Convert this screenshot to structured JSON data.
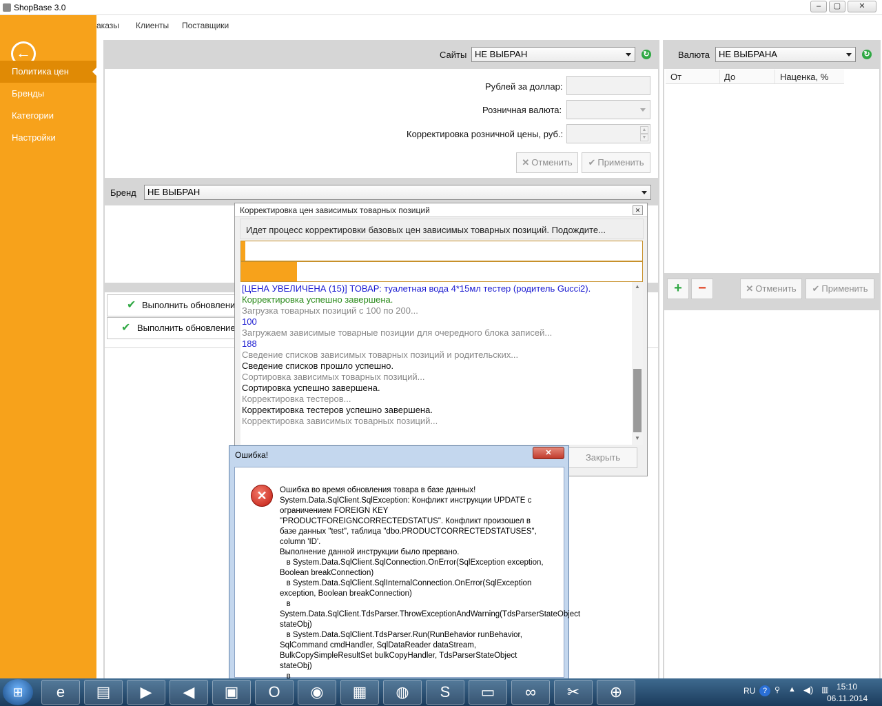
{
  "window": {
    "title": "ShopBase 3.0"
  },
  "top_tabs": [
    "аказы",
    "Клиенты",
    "Поставщики"
  ],
  "sidebar": {
    "items": [
      {
        "label": "Политика цен",
        "active": true
      },
      {
        "label": "Бренды"
      },
      {
        "label": "Категории"
      },
      {
        "label": "Настройки"
      }
    ]
  },
  "sites": {
    "label": "Сайты",
    "value": "НЕ ВЫБРАН"
  },
  "form": {
    "rub_per_dollar_label": "Рублей за доллар:",
    "retail_currency_label": "Розничная валюта:",
    "retail_correction_label": "Корректировка розничной цены, руб.:",
    "cancel_label": "Отменить",
    "apply_label": "Применить"
  },
  "brand": {
    "label": "Бренд",
    "value": "НЕ ВЫБРАН"
  },
  "actions": {
    "run_update_1": "Выполнить обновлени",
    "run_update_2": "Выполнить обновление"
  },
  "currency": {
    "label": "Валюта",
    "value": "НЕ ВЫБРАНА",
    "columns": [
      "От",
      "До",
      "Наценка, %"
    ],
    "cancel_label": "Отменить",
    "apply_label": "Применить",
    "add_icon": "plus-icon",
    "remove_icon": "minus-icon"
  },
  "dialog": {
    "title": "Корректировка цен зависимых товарных позиций",
    "message": "Идет процесс корректировки базовых цен зависимых товарных позиций. Подождите...",
    "progress1": 0.01,
    "progress2": 0.14,
    "log": [
      {
        "text": "[ЦЕНА УВЕЛИЧЕНА (15)] ТОВАР: туалетная вода 4*15мл тестер (родитель Gucci2).",
        "color": "#1a1ad0"
      },
      {
        "text": "Корректировка успешно завершена.",
        "color": "#2a8a1a"
      },
      {
        "text": "Загрузка товарных позиций с 100 по 200...",
        "color": "#888888"
      },
      {
        "text": "100",
        "color": "#1a1ad0"
      },
      {
        "text": "Загружаем зависимые товарные позиции для очередного блока записей...",
        "color": "#888888"
      },
      {
        "text": "188",
        "color": "#1a1ad0"
      },
      {
        "text": "Сведение списков зависимых товарных позиций и родительских...",
        "color": "#888888"
      },
      {
        "text": "Сведение списков прошло успешно.",
        "color": "#111111"
      },
      {
        "text": "Сортировка зависимых товарных позиций...",
        "color": "#888888"
      },
      {
        "text": "Сортировка успешно завершена.",
        "color": "#111111"
      },
      {
        "text": "Корректировка тестеров...",
        "color": "#888888"
      },
      {
        "text": "Корректировка тестеров успешно завершена.",
        "color": "#111111"
      },
      {
        "text": "Корректировка зависимых товарных позиций...",
        "color": "#888888"
      }
    ],
    "close_label": "Закрыть"
  },
  "error": {
    "title": "Ошибка!",
    "text": "Ошибка во время обновления товара в базе данных!\nSystem.Data.SqlClient.SqlException: Конфликт инструкции UPDATE с ограничением FOREIGN KEY \"PRODUCTFOREIGNCORRECTEDSTATUS\". Конфликт произошел в базе данных \"test\", таблица \"dbo.PRODUCTCORRECTEDSTATUSES\", column 'ID'.\nВыполнение данной инструкции было прервано.\n   в System.Data.SqlClient.SqlConnection.OnError(SqlException exception, Boolean breakConnection)\n   в System.Data.SqlClient.SqlInternalConnection.OnError(SqlException exception, Boolean breakConnection)\n   в System.Data.SqlClient.TdsParser.ThrowExceptionAndWarning(TdsParserStateObject stateObj)\n   в System.Data.SqlClient.TdsParser.Run(RunBehavior runBehavior, SqlCommand cmdHandler, SqlDataReader dataStream, BulkCopySimpleResultSet bulkCopyHandler, TdsParserStateObject stateObj)\n   в"
  },
  "taskbar": {
    "apps": [
      "ie-icon",
      "explorer-icon",
      "media-player-icon",
      "volume-app-icon",
      "save-app-icon",
      "opera-icon",
      "chrome-icon",
      "network-icon",
      "firefox-icon",
      "skype-icon",
      "computer-icon",
      "visual-studio-icon",
      "tools-icon",
      "cart-icon"
    ],
    "lang": "RU",
    "time": "15:10",
    "date": "06.11.2014"
  },
  "colors": {
    "accent": "#f7a21b",
    "accent_dark": "#e08a05",
    "taskbar": "#1b3b5c"
  }
}
